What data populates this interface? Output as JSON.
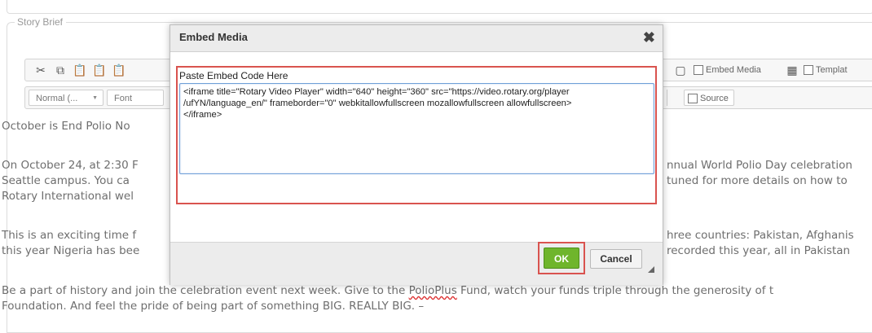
{
  "legend": "Story Brief",
  "toolbar": {
    "embed_media_label": "Embed Media",
    "templates_label": "Templat",
    "format_combo": "Normal (...",
    "font_combo": "Font",
    "source_label": "Source"
  },
  "body": {
    "line1": "October is End Polio No",
    "line2_left": "On October 24, at 2:30 F",
    "line2_right": "nnual World Polio Day celebration",
    "line3_left": "Seattle campus.  You ca",
    "line3_right": "tuned for more details on how to",
    "line4_left": "Rotary International wel",
    "line5_left": "This is an exciting time f",
    "line5_right": "hree countries:  Pakistan, Afghanis",
    "line6_left": "this year Nigeria has bee",
    "line6_right": "recorded this year, all in Pakistan",
    "line7_a": "Be a part of history and join the celebration event next week.  Give to the ",
    "line7_link": "PolioPlus",
    "line7_b": " Fund, watch your funds triple through the generosity of t",
    "line8": "Foundation.  And feel the pride of being part of something BIG.  REALLY BIG. –"
  },
  "modal": {
    "title": "Embed Media",
    "close": "✖",
    "paste_label": "Paste Embed Code Here",
    "embed_code": "<iframe title=\"Rotary Video Player\" width=\"640\" height=\"360\" src=\"https://video.rotary.org/player\n/ufYN/language_en/\" frameborder=\"0\" webkitallowfullscreen mozallowfullscreen allowfullscreen>\n</iframe>",
    "ok_label": "OK",
    "cancel_label": "Cancel"
  },
  "colors": {
    "highlight": "#d9534f",
    "ok_green": "#6fb52c",
    "input_border": "#6f9fd8"
  }
}
